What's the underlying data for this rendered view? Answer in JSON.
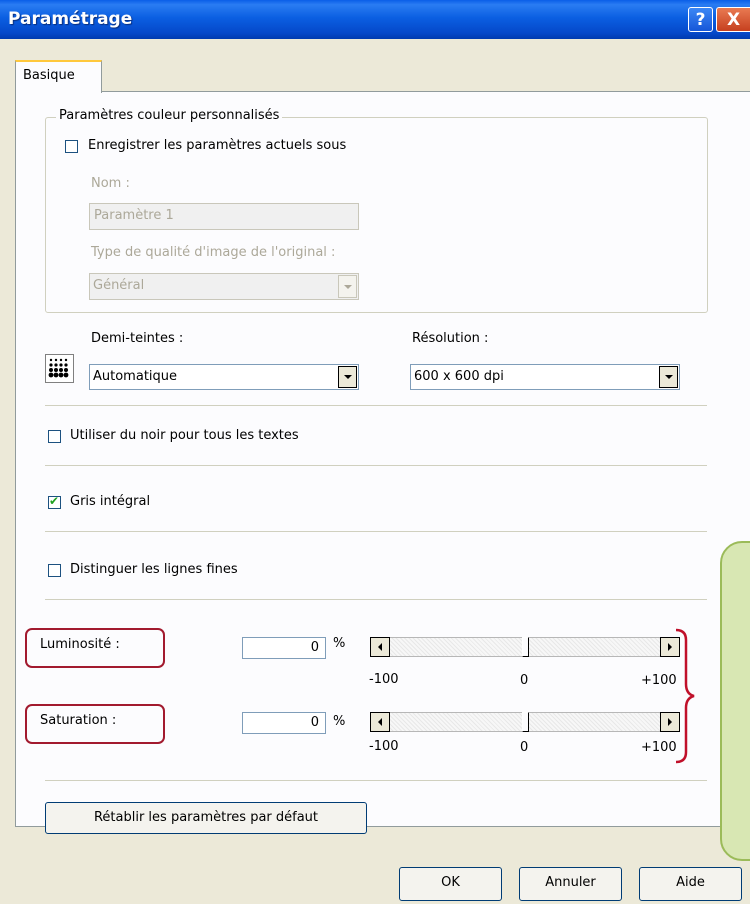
{
  "window": {
    "title": "Paramétrage",
    "help_glyph": "?",
    "close_glyph": "X"
  },
  "tab": {
    "label": "Basique"
  },
  "custom_color": {
    "legend": "Paramètres couleur personnalisés",
    "save_checkbox_label": "Enregistrer les paramètres actuels sous",
    "save_checked": false,
    "name_label": "Nom :",
    "name_value": "Paramètre 1",
    "quality_label": "Type de qualité d'image de l'original :",
    "quality_value": "Général"
  },
  "halftone": {
    "label": "Demi-teintes :",
    "value": "Automatique",
    "icon": "halftone-dots-icon"
  },
  "resolution": {
    "label": "Résolution :",
    "value": "600 x 600 dpi"
  },
  "options": {
    "black_text": {
      "label": "Utiliser du noir pour tous les textes",
      "checked": false
    },
    "true_gray": {
      "label": "Gris intégral",
      "checked": true
    },
    "fine_lines": {
      "label": "Distinguer les lignes fines",
      "checked": false
    }
  },
  "brightness": {
    "label": "Luminosité :",
    "value": "0",
    "unit": "%",
    "min_label": "-100",
    "mid_label": "0",
    "max_label": "+100",
    "level": 0
  },
  "saturation": {
    "label": "Saturation :",
    "value": "0",
    "unit": "%",
    "min_label": "-100",
    "mid_label": "0",
    "max_label": "+100",
    "level": 0
  },
  "reset_button": "Rétablir les paramètres par défaut",
  "footer": {
    "ok": "OK",
    "cancel": "Annuler",
    "help": "Aide"
  },
  "colors": {
    "titlebar": "#0054e3",
    "dialog_bg": "#ece9d8",
    "annotation_red": "#a21a2e",
    "callout_green": "#d8e7b3"
  }
}
